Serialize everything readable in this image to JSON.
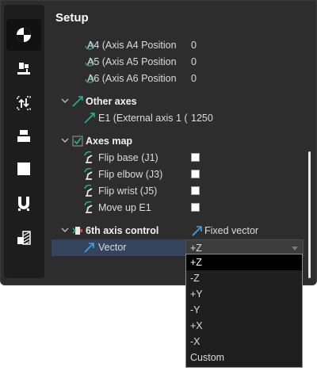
{
  "panel": {
    "title": "Setup"
  },
  "sidebar": {
    "items": [
      {
        "name": "simulation-icon",
        "active": true
      },
      {
        "name": "robot-station-icon",
        "active": false
      },
      {
        "name": "frame-transfer-icon",
        "active": false
      },
      {
        "name": "machine-icon",
        "active": false
      },
      {
        "name": "square-icon",
        "active": false
      },
      {
        "name": "magnet-tool-icon",
        "active": false
      },
      {
        "name": "stock-icon",
        "active": false
      }
    ]
  },
  "rows": {
    "a4": {
      "label": "A4 (Axis A4 Position",
      "value": "0"
    },
    "a5": {
      "label": "A5 (Axis A5 Position",
      "value": "0"
    },
    "a6": {
      "label": "A6 (Axis A6 Position",
      "value": "0"
    },
    "other_axes": {
      "label": "Other axes"
    },
    "e1": {
      "label": "E1 (External axis 1 (",
      "value": "1250"
    },
    "axes_map": {
      "label": "Axes map"
    },
    "flip_base": {
      "label": "Flip base (J1)",
      "checked": false
    },
    "flip_elbow": {
      "label": "Flip elbow (J3)",
      "checked": false
    },
    "flip_wrist": {
      "label": "Flip wrist (J5)",
      "checked": false
    },
    "move_up": {
      "label": "Move up E1",
      "checked": false
    },
    "sixth_axis": {
      "label": "6th axis control",
      "value": "Fixed vector"
    },
    "vector": {
      "label": "Vector",
      "value": "+Z"
    }
  },
  "dropdown": {
    "options": [
      "+Z",
      "-Z",
      "+Y",
      "-Y",
      "+X",
      "-X",
      "Custom"
    ],
    "selected": "+Z"
  },
  "colors": {
    "panel_bg": "#2d2d2d",
    "sidebar_bg": "#1d1d1d",
    "selected_row": "#33445c",
    "accent_icon": "#3fa0e6",
    "teal_icon": "#21b59a"
  }
}
